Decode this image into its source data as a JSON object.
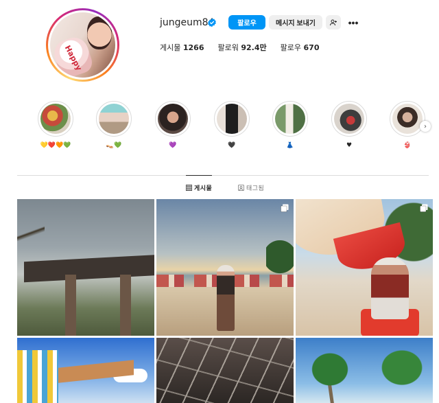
{
  "profile": {
    "username": "jungeum84",
    "verified": true,
    "follow_label": "팔로우",
    "message_label": "메시지 보내기",
    "more_label": "•••",
    "avatar_text": "Happy"
  },
  "stats": [
    {
      "label": "게시물",
      "value": "1266"
    },
    {
      "label": "팔로워",
      "value": "92.4만"
    },
    {
      "label": "팔로우",
      "value": "670"
    }
  ],
  "highlights": [
    {
      "label": "💛❤️🧡💚"
    },
    {
      "label": "👡💚"
    },
    {
      "label": "💜"
    },
    {
      "label": "🖤"
    },
    {
      "label": "👗"
    },
    {
      "label": "♥"
    },
    {
      "label": "👙"
    }
  ],
  "highlights_next": "›",
  "tabs": [
    {
      "label": "게시물",
      "icon": "grid-icon",
      "active": true
    },
    {
      "label": "태그됨",
      "icon": "tagged-icon",
      "active": false
    }
  ],
  "posts": [
    {
      "id": "p1",
      "multi": false,
      "subject": "pavilion-cloudy-sky"
    },
    {
      "id": "p2",
      "multi": true,
      "subject": "beach-sunset-woman"
    },
    {
      "id": "p3",
      "multi": true,
      "subject": "beach-umbrella-woman"
    },
    {
      "id": "p4",
      "multi": false,
      "subject": "waterpark-slide"
    },
    {
      "id": "p5",
      "multi": false,
      "subject": "ceiling-beams"
    },
    {
      "id": "p6",
      "multi": false,
      "subject": "palm-trees"
    }
  ],
  "colors": {
    "accent": "#0095f6",
    "button_secondary": "#efefef",
    "text_primary": "#262626",
    "text_secondary": "#737373",
    "divider": "#dbdbdb"
  }
}
